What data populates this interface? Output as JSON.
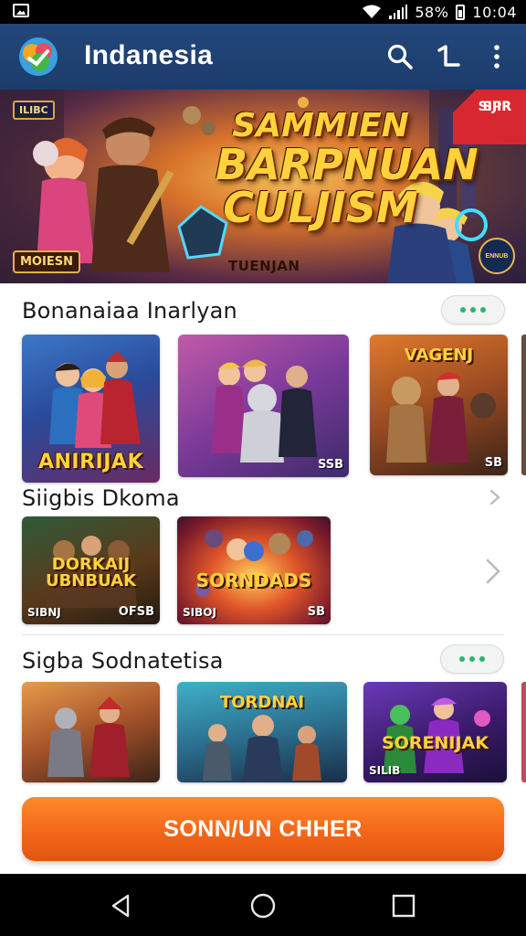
{
  "status_bar": {
    "battery": "58%",
    "time": "10:04"
  },
  "app_bar": {
    "title": "Indanesia",
    "icons": [
      "app-logo",
      "search-icon",
      "tool-icon",
      "overflow-menu-icon"
    ]
  },
  "banner": {
    "title_line1": "SAMMIEN",
    "title_line2": "BARPNUAN",
    "title_line3": "CULJISM",
    "left_badge": "MOIESN",
    "top_left_badge": "ILIBC",
    "subtitle": "TUENJAN",
    "corner_text_1": "SIPR",
    "corner_text_2": "SJIR",
    "emblem": "ENNUB"
  },
  "sections": [
    {
      "title": "Bonanaiaa Inarlyan",
      "tiles": [
        {
          "label": "ANIRIJAK",
          "tag": ""
        },
        {
          "label": "",
          "tag": "SSB"
        },
        {
          "label": "VAGENJ",
          "tag": "SB"
        }
      ]
    },
    {
      "title": "Siigbis Dkoma",
      "tiles": [
        {
          "label": "DORKAIJ UBNBUAK",
          "tag_left": "SIBNJ",
          "tag": "OFSB"
        },
        {
          "label": "SORNDADS",
          "tag_left": "SIBOJ",
          "tag": "SB"
        }
      ]
    },
    {
      "title": "Sigba Sodnatetisa",
      "tiles": [
        {
          "label": "",
          "tag": ""
        },
        {
          "label": "TORDNAI",
          "tag": ""
        },
        {
          "label": "SORENIJAK",
          "tag_left": "SILIB",
          "tag": ""
        }
      ]
    }
  ],
  "cta": {
    "label": "SONN/UN CHHER"
  },
  "colors": {
    "app_bar": "#1c3c6c",
    "accent_green": "#2db36b",
    "cta_orange": "#f2671a"
  }
}
